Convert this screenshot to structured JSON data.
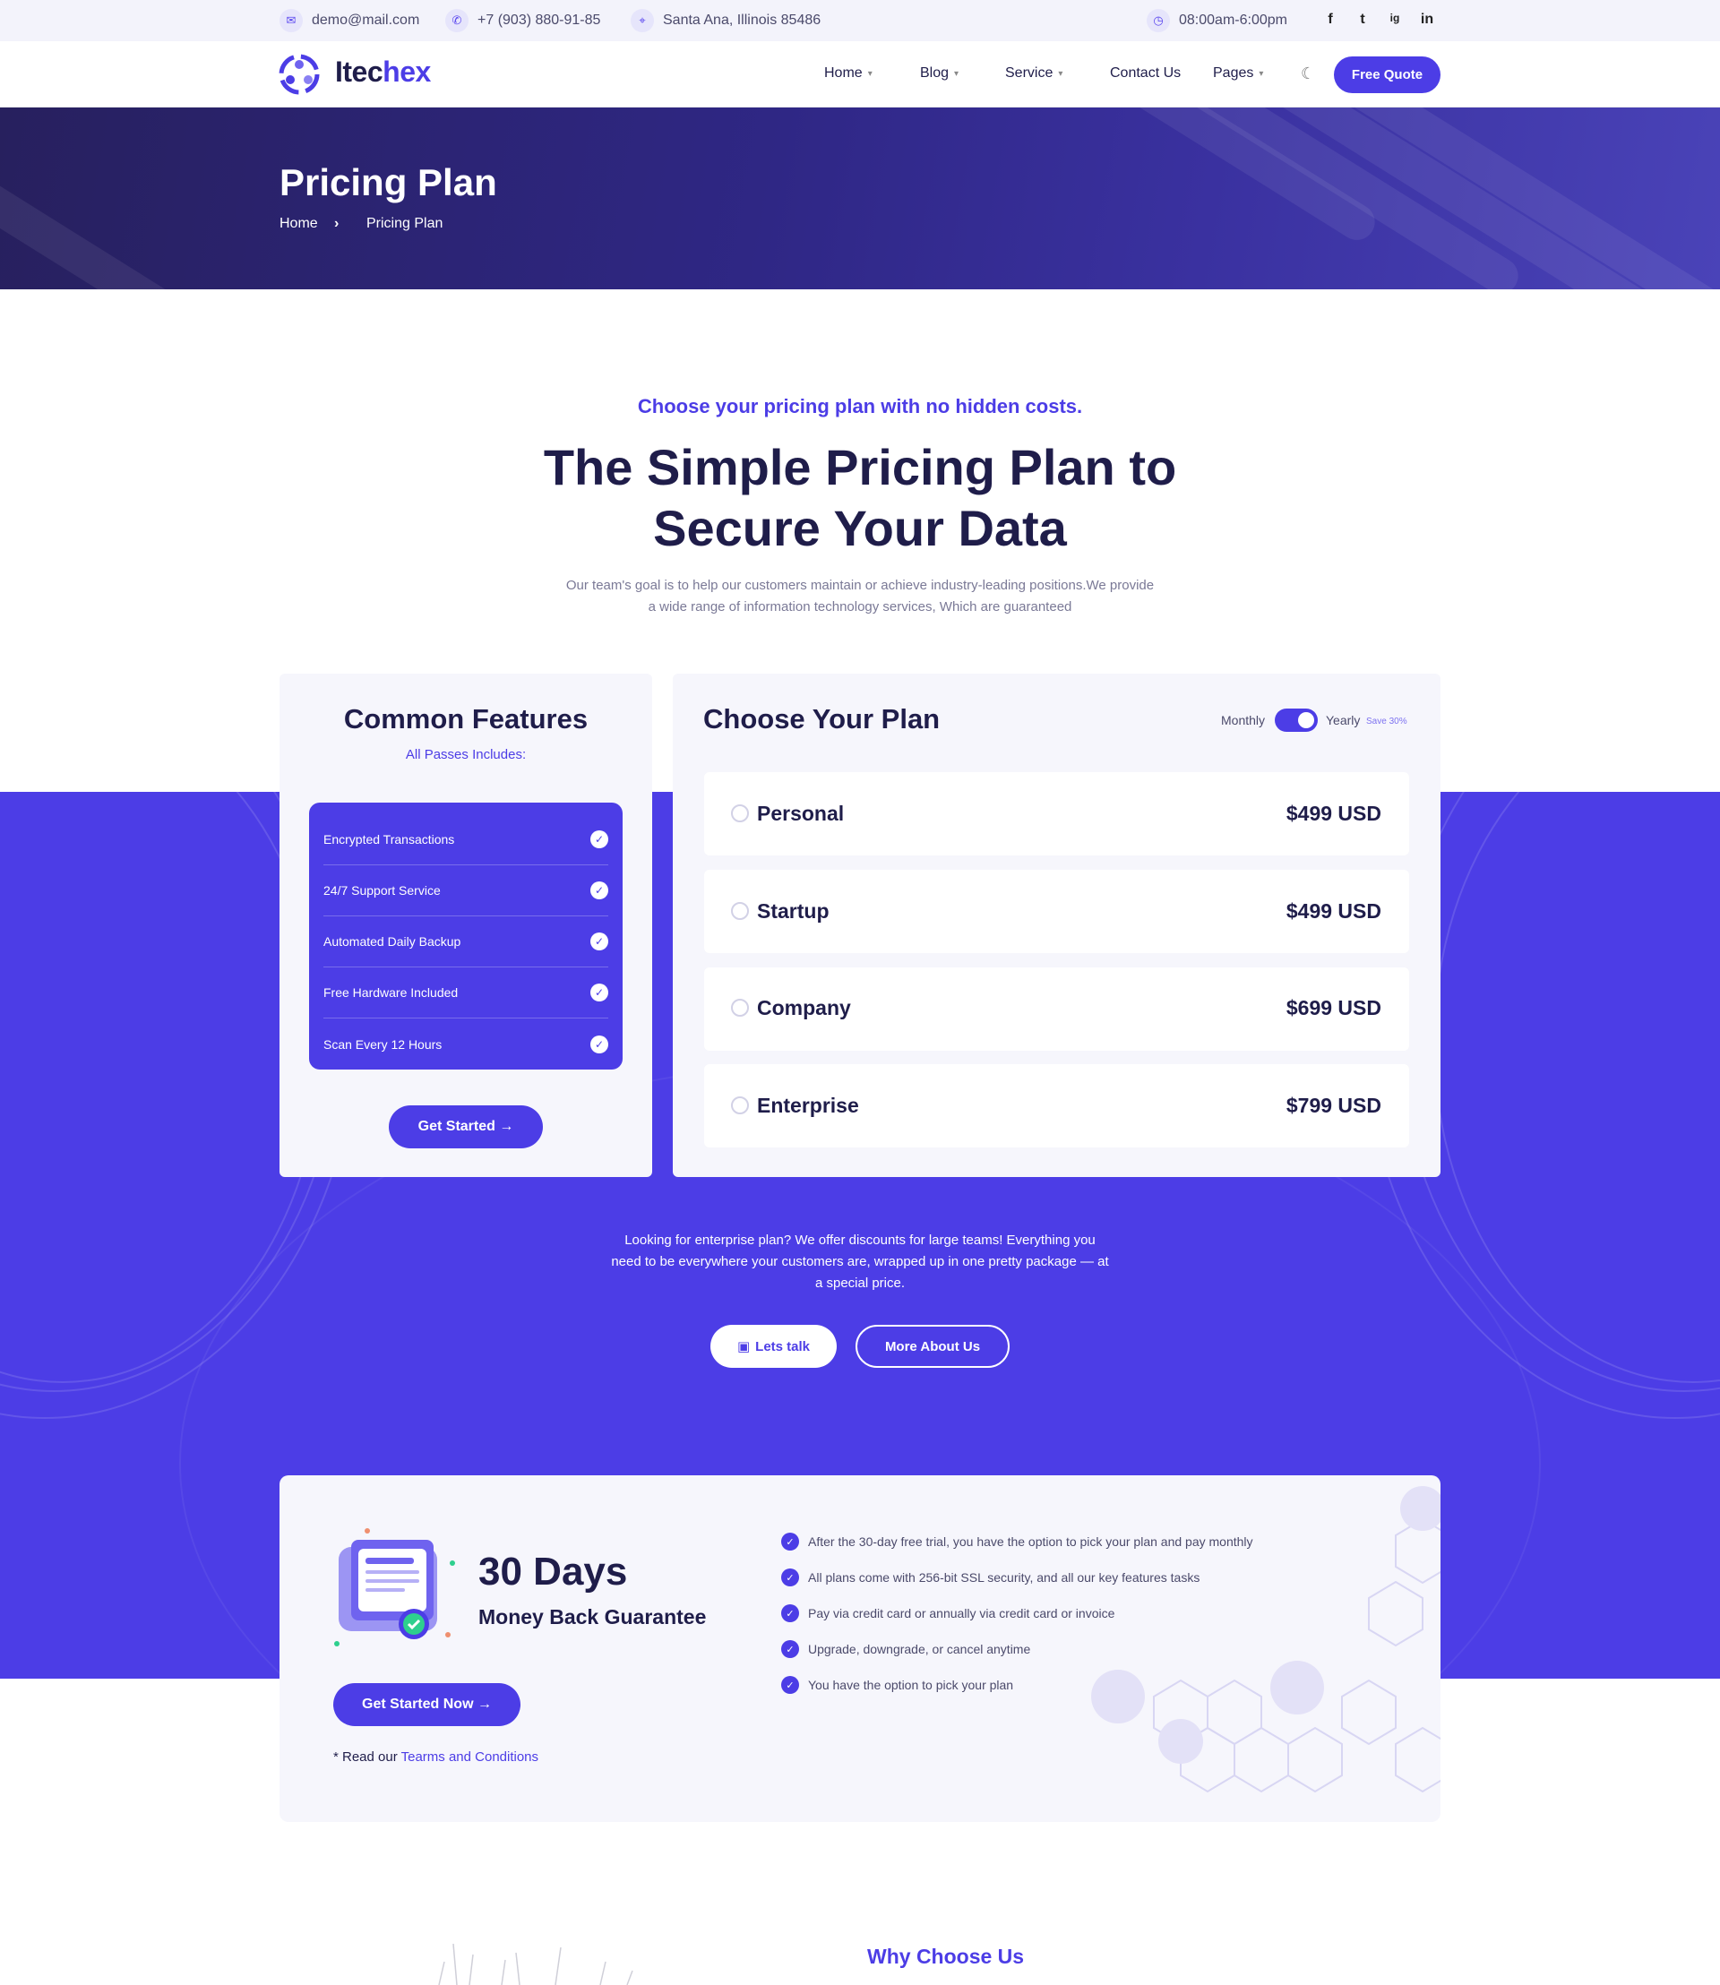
{
  "topbar": {
    "email": "demo@mail.com",
    "phone": "+7 (903) 880-91-85",
    "address": "Santa Ana, Illinois 85486",
    "hours": "08:00am-6:00pm",
    "social": [
      "f",
      "t",
      "ig",
      "in"
    ]
  },
  "nav": {
    "brand_first": "Itec",
    "brand_second": "hex",
    "items": [
      {
        "label": "Home"
      },
      {
        "label": "Blog"
      },
      {
        "label": "Service"
      },
      {
        "label": "Contact Us"
      },
      {
        "label": "Pages"
      }
    ],
    "cta": "Free Quote"
  },
  "hero": {
    "title": "Pricing Plan",
    "breadcrumb_home": "Home",
    "breadcrumb_sep": "›",
    "breadcrumb_current": "Pricing Plan"
  },
  "intro": {
    "tagline": "Choose your pricing plan with no hidden costs.",
    "heading_line1": "The Simple Pricing Plan to",
    "heading_line2": "Secure Your Data",
    "para_line1": "Our team's goal is to help our customers maintain or achieve industry-leading positions.We provide",
    "para_line2": "a wide range of information technology services, Which are guaranteed"
  },
  "features": {
    "title": "Common Features",
    "subtitle": "All Passes Includes:",
    "items": [
      "Encrypted Transactions",
      "24/7 Support Service",
      "Automated Daily Backup",
      "Free Hardware Included",
      "Scan Every 12 Hours"
    ],
    "cta": "Get Started →"
  },
  "plans": {
    "title": "Choose Your Plan",
    "toggle_monthly": "Monthly",
    "toggle_yearly": "Yearly",
    "save_label": "Save 30%",
    "items": [
      {
        "name": "Personal",
        "price": "$499 USD"
      },
      {
        "name": "Startup",
        "price": "$499 USD"
      },
      {
        "name": "Company",
        "price": "$699 USD"
      },
      {
        "name": "Enterprise",
        "price": "$799 USD"
      }
    ]
  },
  "enterprise": {
    "line1": "Looking for enterprise plan? We offer discounts for large teams! Everything you",
    "line2": "need to be everywhere your customers are, wrapped up in one pretty package — at",
    "line3": "a special price.",
    "lets_talk": "Lets talk",
    "more_about": "More About Us"
  },
  "guarantee": {
    "days": "30 Days",
    "subtitle": "Money Back Guarantee",
    "cta": "Get Started Now →",
    "terms_prefix": "* Read our ",
    "terms_link": "Tearms and Conditions",
    "points": [
      "After the 30-day free trial, you have the option to pick your plan and pay monthly",
      "All plans come with 256-bit SSL security, and all our key features tasks",
      "Pay via credit card or annually via credit card or invoice",
      "Upgrade, downgrade, or cancel anytime",
      "You have the option to pick your plan"
    ]
  },
  "why": {
    "title": "Why Choose Us"
  },
  "colors": {
    "accent": "#4c3de6",
    "dark": "#1f1d4a",
    "hero_bg": "#2f2785"
  }
}
